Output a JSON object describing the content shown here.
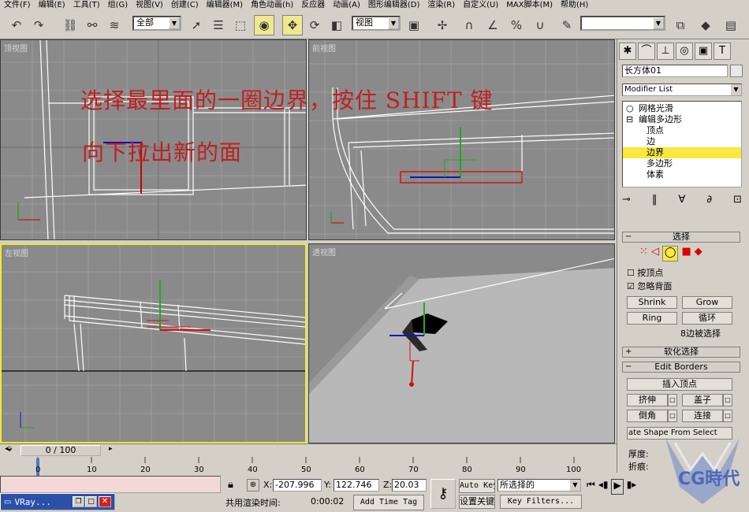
{
  "menu": [
    "文件(F)",
    "编辑(E)",
    "工具(T)",
    "组(G)",
    "视图(V)",
    "创建(C)",
    "编辑器(M)",
    "角色动画(h)",
    "反应器",
    "动画(A)",
    "图形编辑器(D)",
    "渲染(R)",
    "自定义(U)",
    "MAX脚本(M)",
    "帮助(H)"
  ],
  "toolbar": {
    "filter": "全部",
    "coord": "视图"
  },
  "viewports": {
    "top": "顶视图",
    "front": "前视图",
    "left": "左视图",
    "persp": "透视图"
  },
  "overlay": {
    "line1": "选择最里面的一圈边界，按住 SHIFT 键",
    "line2": "向下拉出新的面"
  },
  "panel": {
    "object_name": "长方体01",
    "modifier_list": "Modifier List",
    "stack": [
      {
        "label": "网格光滑"
      },
      {
        "label": "编辑多边形"
      },
      {
        "label": "顶点"
      },
      {
        "label": "边"
      },
      {
        "label": "边界"
      },
      {
        "label": "多边形"
      },
      {
        "label": "体素"
      }
    ],
    "selection": {
      "title": "选择",
      "by_vertex": "按顶点",
      "ignore_backface": "忽略背面",
      "shrink": "Shrink",
      "grow": "Grow",
      "ring": "Ring",
      "loop": "循环",
      "status": "8边被选择"
    },
    "soft_selection": "软化选择",
    "edit_borders": {
      "title": "Edit Borders",
      "insert_vertex": "插入顶点",
      "extrude": "挤伸",
      "cap": "盖子",
      "chamfer": "倒角",
      "connect": "连接",
      "create_shape": "ate Shape From Select",
      "depth": "厚度:",
      "fold": "折痕:"
    }
  },
  "timeline": {
    "frame": "0 / 100",
    "ticks": [
      "0",
      "10",
      "20",
      "30",
      "40",
      "50",
      "60",
      "70",
      "80",
      "90",
      "100"
    ]
  },
  "status": {
    "taskbar": "VRay...",
    "x": "-207.996",
    "y": "122.746",
    "z": "20.03",
    "render_label": "共用渲染时间:",
    "render_time": "0:00:02",
    "add_time_tag": "Add Time Tag",
    "auto_key": "Auto Key",
    "selected": "所选择的",
    "set_key": "设置关键",
    "key_filters": "Key Filters..."
  },
  "watermark": "CG時代"
}
